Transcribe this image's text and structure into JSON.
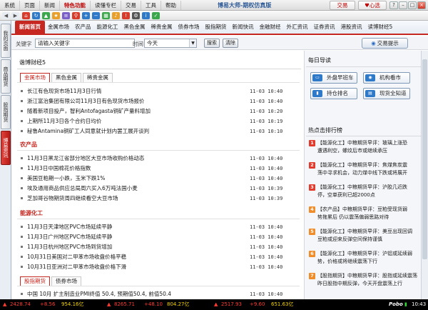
{
  "menu": [
    "系统",
    "页面",
    "新闻",
    "特色功能",
    "读懂专栏",
    "交易",
    "工具",
    "帮助"
  ],
  "menu_highlight_index": 3,
  "app_title": "博易大师-期权仿真版",
  "trade_button": "交易",
  "heart_button": "心选",
  "left_tabs": [
    {
      "label": "我的页面",
      "active": false
    },
    {
      "label": "商品期货",
      "active": false
    },
    {
      "label": "股指期货",
      "active": false
    },
    {
      "label": "博易资讯",
      "active": true
    }
  ],
  "category_tabs": [
    "新闻首页",
    "金属市场",
    "农产品",
    "能源化工",
    "黑色金属",
    "稀贵金属",
    "债券市场",
    "股指期货",
    "新闻快讯",
    "金融财经",
    "外汇资讯",
    "证券资讯",
    "港股资讯",
    "读博财经5"
  ],
  "search": {
    "keyword_label": "关键字",
    "keyword_placeholder": "请输入关键字",
    "time_label": "时间",
    "time_value": "今天",
    "search_button": "搜索",
    "clear_button": "清除",
    "tip_button": "交易提示"
  },
  "main": {
    "section_title": "谐博财经5",
    "subtabs": [
      "金属市场",
      "黑色金属",
      "稀贵金属"
    ],
    "groups": [
      {
        "heading": "",
        "items": [
          {
            "title": "长江有色现货市场11月3日行情",
            "time": "11-03 10:40"
          },
          {
            "title": "浙江富治集团有限公司11月3日有色现货市场报价",
            "time": "11-03 10:40"
          },
          {
            "title": "随着新项目投产，智利Antofagasta铜矿产量料增加",
            "time": "11-03 10:20"
          },
          {
            "title": "上期所11月3日各个合约日均价",
            "time": "11-03 10:19"
          },
          {
            "title": "秘鲁Antamina铜矿工人同意就计划内罢工展开谈判",
            "time": "11-03 10:10"
          }
        ]
      },
      {
        "heading": "农产品",
        "items": [
          {
            "title": "11月3日黑龙江省部分地区大豆市场收购价格动态",
            "time": "11-03 10:40"
          },
          {
            "title": "11月3日中国棉花价格指数",
            "time": "11-03 10:40"
          },
          {
            "title": "美国豆粕期一小跌，玉米下跌1%",
            "time": "11-03 10:40"
          },
          {
            "title": "埃及通用商品供应总局周六买入6万吨法国小麦",
            "time": "11-03 10:39"
          },
          {
            "title": "芝加哥谷物期货周四继续看空大豆市场",
            "time": "11-03 10:39"
          }
        ]
      },
      {
        "heading": "能源化工",
        "items": [
          {
            "title": "11月3日天津地区PVC市场延续平静",
            "time": "11-03 10:40"
          },
          {
            "title": "11月3日广州地区PVC市场延续平静",
            "time": "11-03 10:40"
          },
          {
            "title": "11月3日杭州地区PVC市场到货增加",
            "time": "11-03 10:40"
          },
          {
            "title": "10月31日美国对二甲苯市场收盘价格平稳",
            "time": "11-03 10:40"
          },
          {
            "title": "10月31日亚洲对二甲苯市场收盘价格下滑",
            "time": "11-03 10:40"
          }
        ]
      }
    ],
    "bond_tabs": [
      "股指期货",
      "债券市场"
    ],
    "partial_item": {
      "title": "中国 10月 扩主制造业PMI终值 50.4, 预期值50.4, 前值50.4",
      "time": "11-03 10:40"
    }
  },
  "right": {
    "daily_title": "每日导读",
    "quick_buttons": [
      {
        "label": "外盘早班车",
        "icon": "car-icon"
      },
      {
        "label": "机构看市",
        "icon": "eye-icon"
      },
      {
        "label": "持仓排名",
        "icon": "ranking-icon"
      },
      {
        "label": "现货全知道",
        "icon": "book-icon"
      }
    ],
    "hot_title": "热点击排行榜",
    "hot_items": [
      {
        "rank": "1",
        "line1": "【能源化工】中粮期货早评：玻璃上涨恐",
        "line2": "遭遇利空，螺纹后市或继续承压"
      },
      {
        "rank": "2",
        "line1": "【能源化工】中粮期货早评：焦煤焦炭震",
        "line2": "荡中寻求机会，动力煤中线下跌或将展开"
      },
      {
        "rank": "3",
        "line1": "【能源化工】中粮期货早评：沪胶几近跌",
        "line2": "停，空单获利已超2000点"
      },
      {
        "rank": "4",
        "line1": "【农产品】中粮期货早评：豆粕受现货弱",
        "line2": "势拖累后 仍以震荡偏弱思路对待"
      },
      {
        "rank": "5",
        "line1": "【能源化工】中粮期货早评：美豆出现回调",
        "line2": "豆粕或迎来反弹空间保持谨慎"
      },
      {
        "rank": "6",
        "line1": "【能源化工】中粮期货早评：沪铝或延续弱",
        "line2": "势，价格或将继续震荡下行"
      },
      {
        "rank": "7",
        "line1": "【股指期货】中粮期货早评：股指或延续震荡",
        "line2": "昨日股指中期反弹，今天开盘震荡上行"
      }
    ]
  },
  "status": [
    {
      "text": "2428.74",
      "color": "red"
    },
    {
      "text": "+8.56",
      "color": "red"
    },
    {
      "text": "954.16亿",
      "color": "yel"
    },
    {
      "text": "8265.71",
      "color": "red"
    },
    {
      "text": "+48.10",
      "color": "red"
    },
    {
      "text": "804.27亿",
      "color": "yel"
    },
    {
      "text": "2517.93",
      "color": "red"
    },
    {
      "text": "+9.60",
      "color": "red"
    },
    {
      "text": "651.63亿",
      "color": "yel"
    }
  ],
  "status_logo": "Pobo",
  "status_time": "10:43",
  "colors": {
    "accent_red": "#c62720",
    "menu_highlight": "#c00000"
  }
}
